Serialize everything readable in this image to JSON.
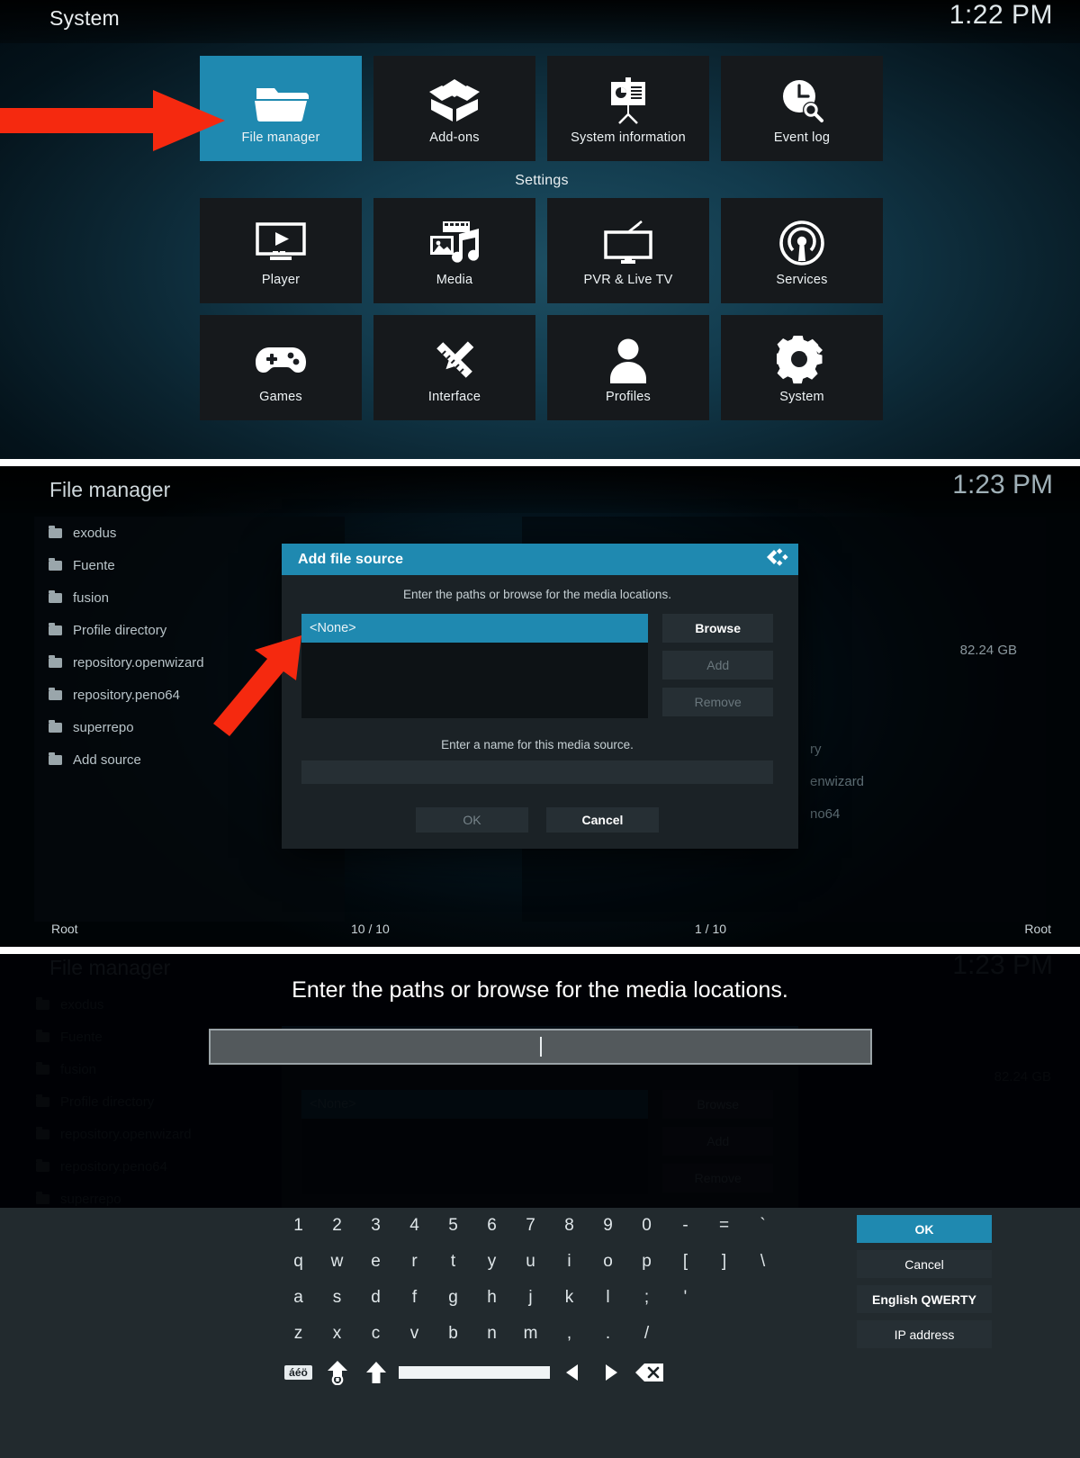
{
  "panel_system": {
    "title": "System",
    "clock": "1:22 PM",
    "settings_caption": "Settings",
    "top_tiles": [
      {
        "label": "File manager",
        "icon": "folder-icon",
        "selected": true
      },
      {
        "label": "Add-ons",
        "icon": "addon-box-icon",
        "selected": false
      },
      {
        "label": "System information",
        "icon": "presentation-chart-icon",
        "selected": false
      },
      {
        "label": "Event log",
        "icon": "clock-search-icon",
        "selected": false
      }
    ],
    "settings_tiles": [
      {
        "label": "Player",
        "icon": "monitor-play-icon"
      },
      {
        "label": "Media",
        "icon": "photo-music-icon"
      },
      {
        "label": "PVR & Live TV",
        "icon": "tv-antenna-icon"
      },
      {
        "label": "Services",
        "icon": "broadcast-icon"
      },
      {
        "label": "Games",
        "icon": "gamepad-icon"
      },
      {
        "label": "Interface",
        "icon": "pencil-ruler-icon"
      },
      {
        "label": "Profiles",
        "icon": "person-icon"
      },
      {
        "label": "System",
        "icon": "gear-wrench-icon"
      }
    ]
  },
  "panel_filemanager": {
    "title": "File manager",
    "clock": "1:23 PM",
    "left_items": [
      "exodus",
      "Fuente",
      "fusion",
      "Profile directory",
      "repository.openwizard",
      "repository.peno64",
      "superrepo",
      "Add source"
    ],
    "right_items": [
      "ry",
      "enwizard",
      "no64"
    ],
    "right_size": "82.24 GB",
    "status": {
      "left_path": "Root",
      "left_count": "10 / 10",
      "right_count": "1 / 10",
      "right_path": "Root"
    },
    "dialog": {
      "title": "Add file source",
      "logo_icon": "kodi-logo-icon",
      "path_hint": "Enter the paths or browse for the media locations.",
      "selected_path": "<None>",
      "browse_label": "Browse",
      "add_label": "Add",
      "remove_label": "Remove",
      "name_hint": "Enter a name for this media source.",
      "name_value": "",
      "ok_label": "OK",
      "cancel_label": "Cancel"
    }
  },
  "panel_keyboard": {
    "background": {
      "title": "File manager",
      "clock": "1:23 PM",
      "items": [
        "exodus",
        "Fuente",
        "fusion",
        "Profile directory",
        "repository.openwizard",
        "repository.peno64",
        "superrepo"
      ],
      "selected_path": "<None>",
      "browse_label": "Browse",
      "add_label": "Add",
      "remove_label": "Remove",
      "size": "82.24 GB"
    },
    "prompt": "Enter the paths or browse for the media locations.",
    "input_value": "",
    "rows": [
      [
        "1",
        "2",
        "3",
        "4",
        "5",
        "6",
        "7",
        "8",
        "9",
        "0",
        "-",
        "=",
        "`"
      ],
      [
        "q",
        "w",
        "e",
        "r",
        "t",
        "y",
        "u",
        "i",
        "o",
        "p",
        "[",
        "]",
        "\\"
      ],
      [
        "a",
        "s",
        "d",
        "f",
        "g",
        "h",
        "j",
        "k",
        "l",
        ";",
        "'"
      ],
      [
        "z",
        "x",
        "c",
        "v",
        "b",
        "n",
        "m",
        ",",
        ".",
        "/"
      ]
    ],
    "special_keys": [
      {
        "name": "accent-key",
        "label": "áéö"
      },
      {
        "name": "caps-lock-key",
        "label": ""
      },
      {
        "name": "shift-key",
        "label": ""
      },
      {
        "name": "space-key",
        "label": ""
      },
      {
        "name": "cursor-left-key",
        "label": ""
      },
      {
        "name": "cursor-right-key",
        "label": ""
      },
      {
        "name": "backspace-key",
        "label": ""
      }
    ],
    "side_buttons": [
      {
        "label": "OK",
        "selected": true
      },
      {
        "label": "Cancel",
        "selected": false
      },
      {
        "label": "English QWERTY",
        "selected": false
      },
      {
        "label": "IP address",
        "selected": false
      }
    ]
  },
  "colors": {
    "accent": "#1f89b0",
    "arrow": "#f5290f",
    "tile_bg": "#16191c",
    "panel_bg": "#222a2e"
  }
}
